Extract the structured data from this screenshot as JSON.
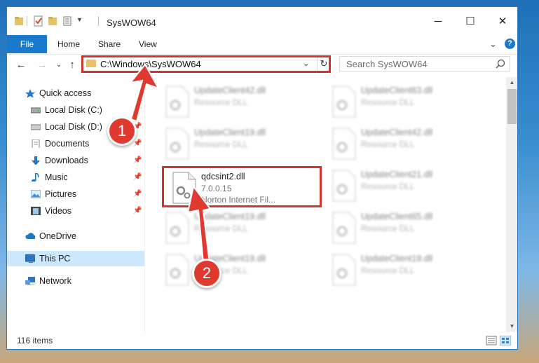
{
  "window": {
    "title": "SysWOW64",
    "controls": [
      "─",
      "☐",
      "✕"
    ]
  },
  "ribbon": {
    "tabs": [
      "File",
      "Home",
      "Share",
      "View"
    ],
    "expand": "⌄",
    "help": "?"
  },
  "nav": {
    "back": "←",
    "forward": "→",
    "recent": "⌄",
    "up": "↑"
  },
  "address": {
    "path": "C:\\Windows\\SysWOW64",
    "dropdown": "⌄",
    "refresh": "↻"
  },
  "search": {
    "placeholder": "Search SysWOW64"
  },
  "sidebar": {
    "items": [
      {
        "label": "Quick access",
        "icon": "star-icon"
      },
      {
        "label": "Local Disk (C:)",
        "icon": "drive-icon",
        "pinned": true
      },
      {
        "label": "Local Disk (D:)",
        "icon": "drive-icon",
        "pinned": true
      },
      {
        "label": "Documents",
        "icon": "documents-icon",
        "pinned": true
      },
      {
        "label": "Downloads",
        "icon": "download-icon",
        "pinned": true
      },
      {
        "label": "Music",
        "icon": "music-icon",
        "pinned": true
      },
      {
        "label": "Pictures",
        "icon": "pictures-icon",
        "pinned": true
      },
      {
        "label": "Videos",
        "icon": "videos-icon",
        "pinned": true
      },
      {
        "label": "OneDrive",
        "icon": "cloud-icon"
      },
      {
        "label": "This PC",
        "icon": "computer-icon",
        "selected": true
      },
      {
        "label": "Network",
        "icon": "network-icon"
      }
    ],
    "pin_glyph": "📌"
  },
  "files": [
    {
      "name": "UpdateClient42.dll",
      "desc": "Resource DLL",
      "blurred": true
    },
    {
      "name": "UpdateClient63.dll",
      "desc": "Resource DLL",
      "blurred": true
    },
    {
      "name": "UpdateClient19.dll",
      "desc": "Resource DLL",
      "blurred": true
    },
    {
      "name": "UpdateClient42.dll",
      "desc": "Resource DLL",
      "blurred": true
    },
    {
      "name": "qdcsint2.dll",
      "desc": "7.0.0.15",
      "desc2": "Norton Internet Fil...",
      "blurred": false
    },
    {
      "name": "UpdateClient21.dll",
      "desc": "Resource DLL",
      "blurred": true
    },
    {
      "name": "UpdateClient19.dll",
      "desc": "Resource DLL",
      "blurred": true
    },
    {
      "name": "UpdateClient65.dll",
      "desc": "Resource DLL",
      "blurred": true
    },
    {
      "name": "UpdateClient19.dll",
      "desc": "Resource DLL",
      "blurred": true
    },
    {
      "name": "UpdateClient19.dll",
      "desc": "Resource DLL",
      "blurred": true
    }
  ],
  "status": {
    "count": "116 items"
  },
  "annotations": {
    "step1": "1",
    "step2": "2",
    "color": "#e03a30"
  }
}
